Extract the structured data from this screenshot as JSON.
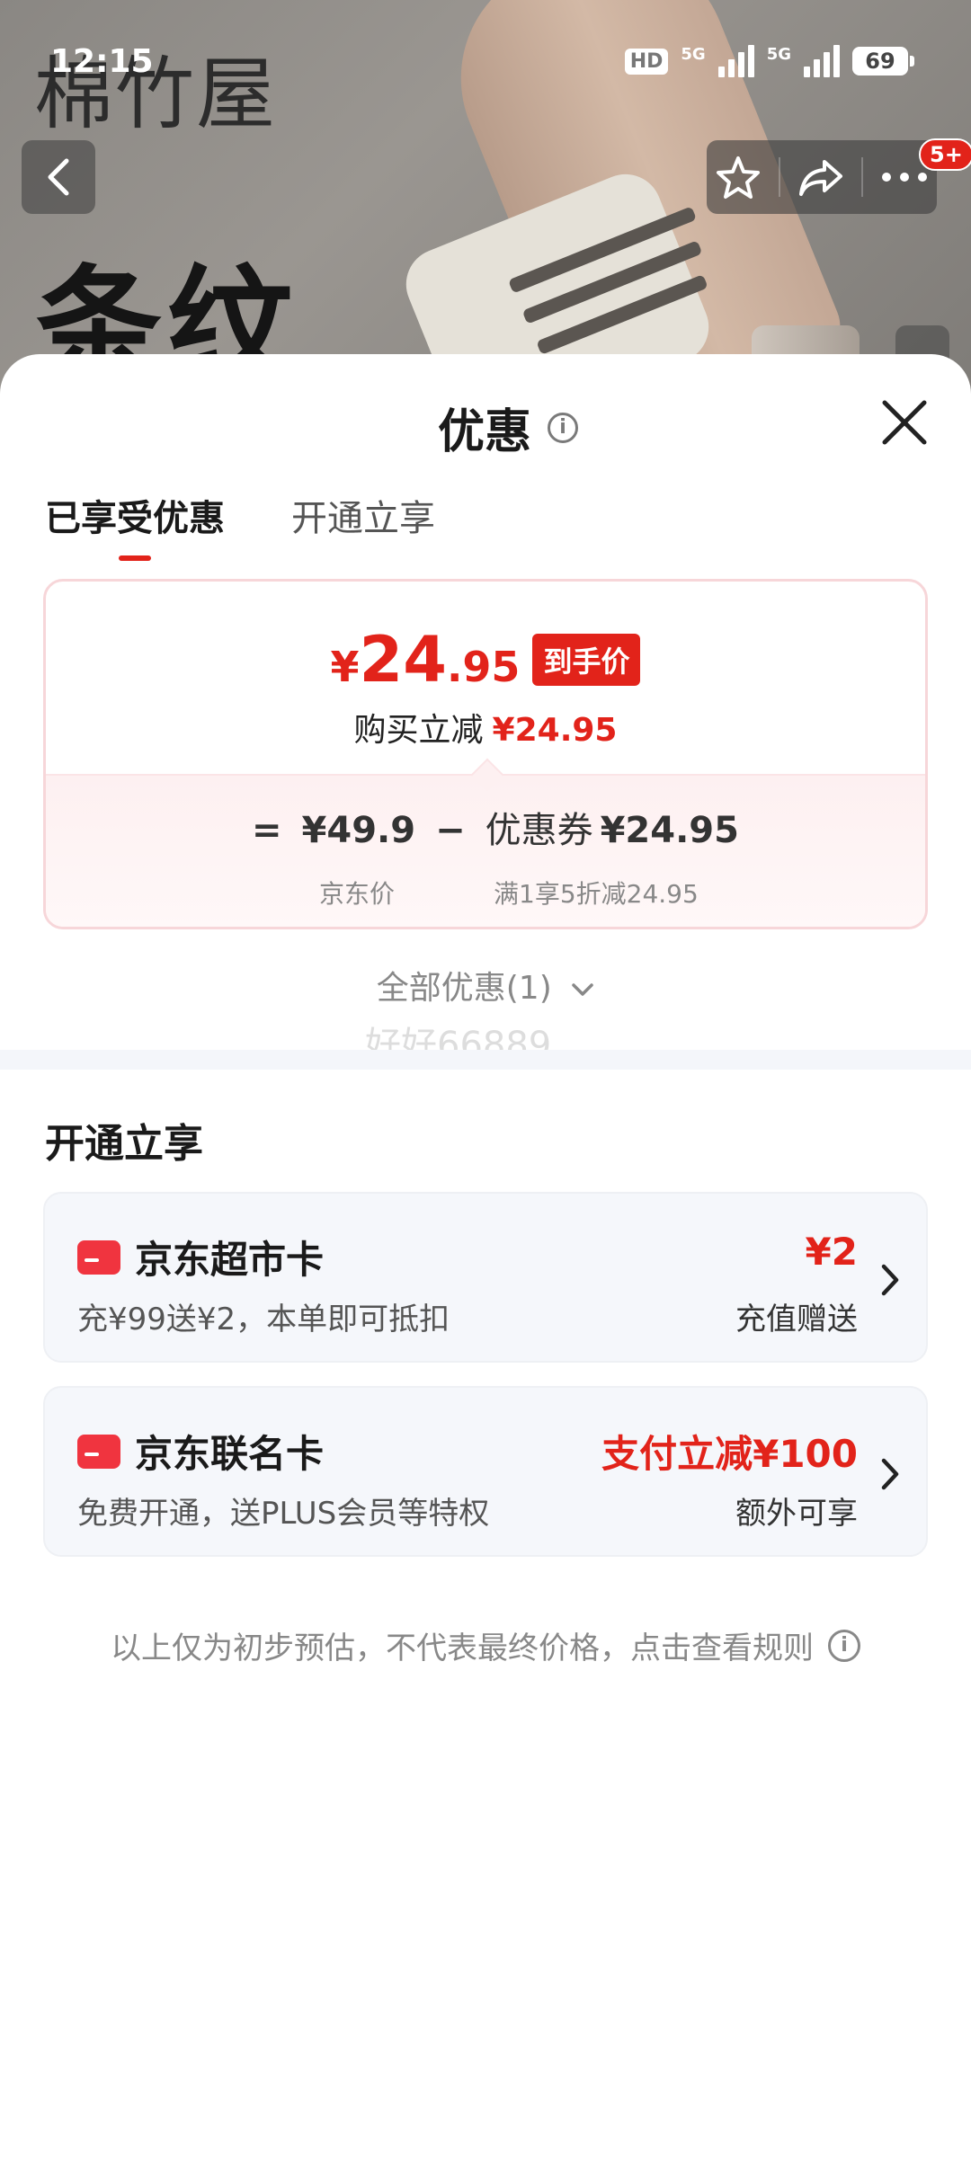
{
  "status_bar": {
    "time": "12:15",
    "hd_label": "HD",
    "signal1_label": "5G",
    "signal2_label": "5G",
    "battery": "69"
  },
  "background": {
    "brand": "棉竹屋",
    "title": "条纹",
    "message_badge": "5+",
    "colors": {
      "accent_red": "#e2231a"
    }
  },
  "sheet": {
    "title": "优惠",
    "tabs": [
      {
        "label": "已享受优惠",
        "active": true
      },
      {
        "label": "开通立享",
        "active": false
      }
    ],
    "price_card": {
      "yen": "¥",
      "price_int": "24",
      "price_dec": ".95",
      "tag": "到手价",
      "sub_label": "购买立减",
      "sub_value": "¥24.95",
      "formula": {
        "equals": "=",
        "jd_price": "¥49.9",
        "minus": "−",
        "coupon_label": "优惠券",
        "coupon_value": "¥24.95",
        "jd_price_label": "京东价",
        "coupon_desc": "满1享5折减24.95"
      }
    },
    "all_offers": "全部优惠(1)",
    "watermark": "好好66889",
    "section_title": "开通立享",
    "offers": [
      {
        "name": "京东超市卡",
        "desc": "充¥99送¥2，本单即可抵扣",
        "right_top": "¥2",
        "right_bottom": "充值赠送"
      },
      {
        "name": "京东联名卡",
        "desc": "免费开通，送PLUS会员等特权",
        "right_top": "支付立减¥100",
        "right_bottom": "额外可享"
      }
    ],
    "footer_note": "以上仅为初步预估，不代表最终价格，点击查看规则"
  }
}
